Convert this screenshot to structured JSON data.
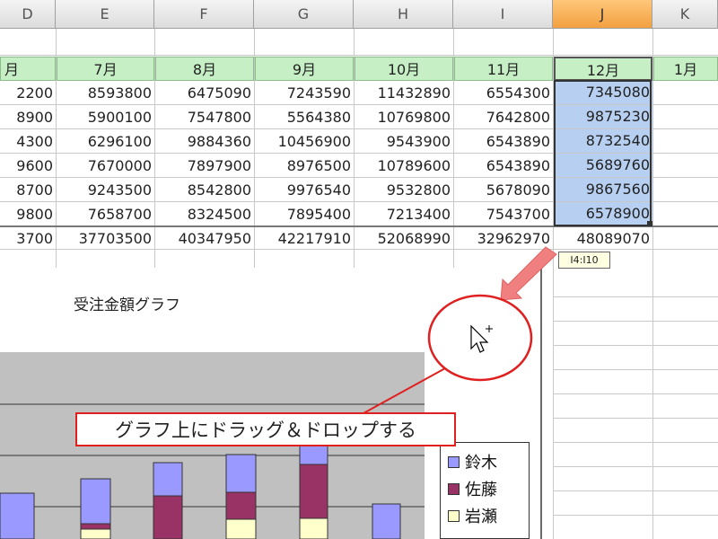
{
  "columns": [
    {
      "label": "D",
      "visible": "ⅅ"
    },
    {
      "label": "E"
    },
    {
      "label": "F"
    },
    {
      "label": "G"
    },
    {
      "label": "H"
    },
    {
      "label": "I"
    },
    {
      "label": "J"
    },
    {
      "label": "K"
    }
  ],
  "months": [
    "月",
    "7月",
    "8月",
    "9月",
    "10月",
    "11月",
    "12月",
    "1月"
  ],
  "rows": [
    [
      "2200",
      "8593800",
      "6475090",
      "7243590",
      "11432890",
      "6554300",
      "7345080"
    ],
    [
      "8900",
      "5900100",
      "7547800",
      "5564380",
      "10769800",
      "7642800",
      "9875230"
    ],
    [
      "4300",
      "6296100",
      "9884360",
      "10456900",
      "9543900",
      "6543890",
      "8732540"
    ],
    [
      "9600",
      "7670000",
      "7897900",
      "8976500",
      "10789600",
      "6543890",
      "5689760"
    ],
    [
      "8700",
      "9243500",
      "8542800",
      "9976540",
      "9532800",
      "5678090",
      "9867560"
    ],
    [
      "9800",
      "7658700",
      "8324500",
      "7895400",
      "7213400",
      "7543700",
      "6578900"
    ]
  ],
  "totals": [
    "3700",
    "37703500",
    "40347950",
    "42217910",
    "52068990",
    "32962970",
    "48089070"
  ],
  "tooltip": "I4:I10",
  "chart": {
    "title": "受注金額グラフ",
    "legend": [
      "鈴木",
      "佐藤",
      "岩瀬"
    ],
    "colors": {
      "suzuki": "#9999ff",
      "sato": "#993366",
      "iwase": "#ffffcc",
      "plot": "#c0c0c0"
    }
  },
  "callout_text": "グラフ上にドラッグ＆ドロップする",
  "accent": {
    "arrow": "#f08080",
    "circle": "#e02020",
    "selected_header": "#f2a040"
  }
}
